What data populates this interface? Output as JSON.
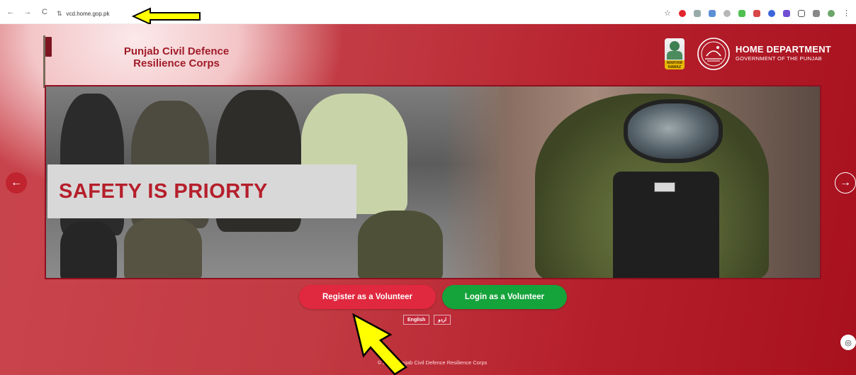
{
  "browser": {
    "nav_back": "←",
    "nav_forward": "→",
    "nav_reload": "C",
    "tune_icon": "⇅",
    "url": "vcd.home.gop.pk",
    "star_icon": "☆",
    "menu_icon": "⋮"
  },
  "header": {
    "brand_line1": "Punjab Civil Defence",
    "brand_line2": "Resilience Corps",
    "portrait_tag": "MARYAM NAWAZ",
    "dept_title": "HOME DEPARTMENT",
    "dept_subtitle": "GOVERNMENT OF THE PUNJAB"
  },
  "carousel": {
    "slogan": "SAFETY IS PRIORTY",
    "prev_icon": "←",
    "next_icon": "→"
  },
  "actions": {
    "register": "Register as a Volunteer",
    "login": "Login as a Volunteer"
  },
  "language": {
    "english": "English",
    "urdu": "اردو"
  },
  "footer": {
    "text": "© 2025 Punjab Civil Defence Resilience Corps"
  },
  "help_icon": "◎",
  "colors": {
    "brand_red": "#b51f2b",
    "register_btn": "#e0283f",
    "login_btn": "#15a33b",
    "annotation_arrow": "#ffff00"
  }
}
